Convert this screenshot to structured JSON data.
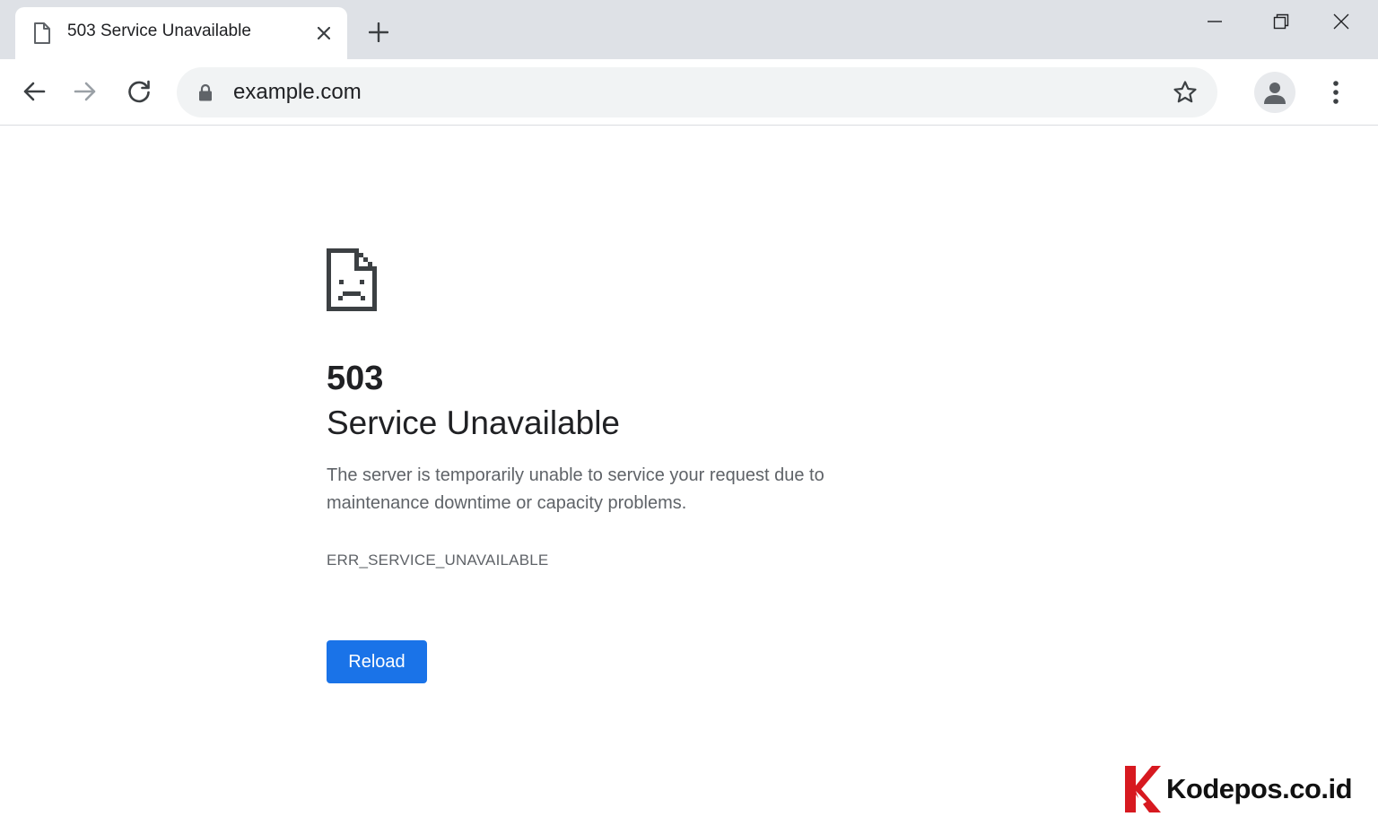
{
  "browser": {
    "tab": {
      "title": "503 Service Unavailable",
      "favicon": "document-icon"
    },
    "new_tab_icon": "plus-icon",
    "window_controls": [
      "minimize-icon",
      "restore-icon",
      "close-icon"
    ],
    "toolbar": {
      "back_icon": "arrow-left-icon",
      "forward_icon": "arrow-right-icon",
      "reload_icon": "reload-icon",
      "url": "example.com",
      "security_icon": "lock-icon",
      "bookmark_icon": "star-icon",
      "profile_icon": "avatar-icon",
      "menu_icon": "kebab-menu-icon"
    }
  },
  "error_page": {
    "icon": "sad-page-icon",
    "code": "503",
    "title": "Service Unavailable",
    "description": "The server is temporarily unable to service your request due to maintenance downtime or capacity problems.",
    "error_detail": "ERR_SERVICE_UNAVAILABLE",
    "reload_label": "Reload"
  },
  "watermark": {
    "text": "Kodepos.co.id",
    "logo_color": "#d71920"
  },
  "colors": {
    "tabstrip": "#dee1e6",
    "omnibox": "#f1f3f4",
    "accent": "#1a73e8",
    "text_primary": "#202124",
    "text_secondary": "#5f6368"
  }
}
